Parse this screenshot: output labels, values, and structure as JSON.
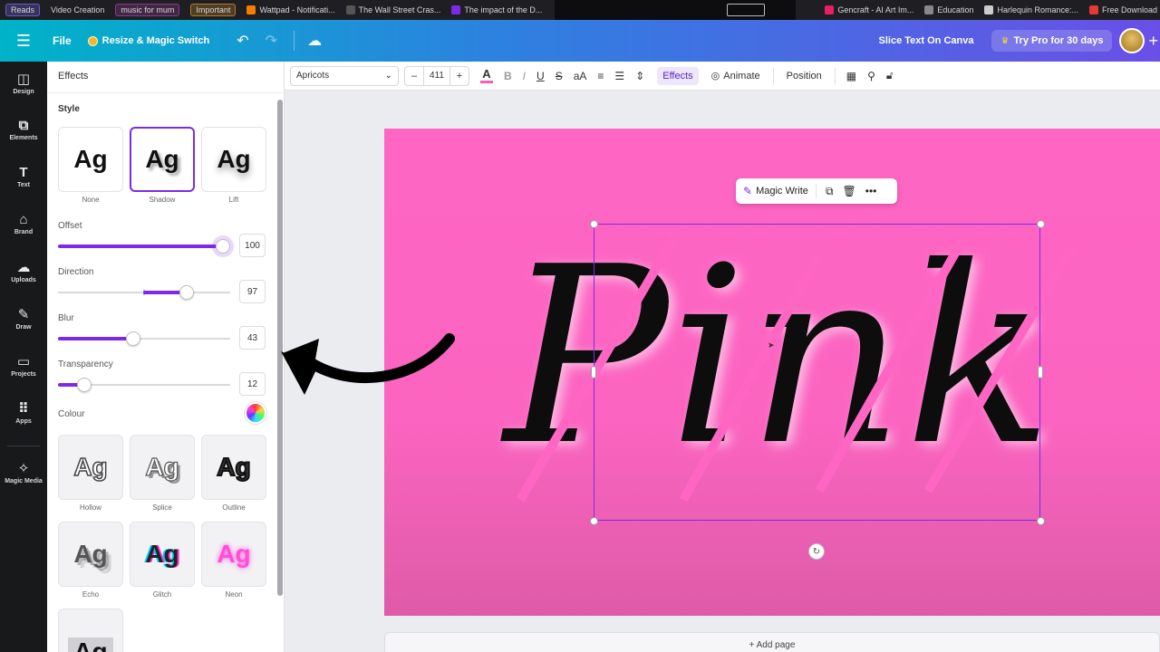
{
  "bookmarks": {
    "items": [
      {
        "label": "Reads",
        "chip": true,
        "color": "#6a5acd"
      },
      {
        "label": "Video Creation",
        "chip": false,
        "color": ""
      },
      {
        "label": "music for mum",
        "chip": true,
        "color": "#8b3a8b"
      },
      {
        "label": "Important",
        "chip": true,
        "color": "#b57a2a"
      },
      {
        "label": "Wattpad - Notificati...",
        "chip": false,
        "color": "#f57c00"
      },
      {
        "label": "The Wall Street Cras...",
        "chip": false,
        "color": "#555555"
      },
      {
        "label": "The impact of the D...",
        "chip": false,
        "color": "#7d2ae8"
      }
    ],
    "right_items": [
      {
        "label": "Gencraft - AI Art Im...",
        "color": "#e91e63"
      },
      {
        "label": "Education",
        "color": "#888888"
      },
      {
        "label": "Harlequin Romance:...",
        "color": "#cccccc"
      },
      {
        "label": "Free Download Books",
        "color": "#e53935"
      }
    ]
  },
  "topbar": {
    "file": "File",
    "resize": "Resize & Magic Switch",
    "doc_title": "Slice Text On Canva",
    "try_pro": "Try Pro for 30 days"
  },
  "rail": {
    "items": [
      {
        "label": "Design",
        "icon": "design-icon",
        "glyph": "◫"
      },
      {
        "label": "Elements",
        "icon": "elements-icon",
        "glyph": "⧉"
      },
      {
        "label": "Text",
        "icon": "text-icon",
        "glyph": "T"
      },
      {
        "label": "Brand",
        "icon": "brand-icon",
        "glyph": "⌂"
      },
      {
        "label": "Uploads",
        "icon": "uploads-icon",
        "glyph": "☁"
      },
      {
        "label": "Draw",
        "icon": "draw-icon",
        "glyph": "✎"
      },
      {
        "label": "Projects",
        "icon": "projects-icon",
        "glyph": "▭"
      },
      {
        "label": "Apps",
        "icon": "apps-icon",
        "glyph": "⠿"
      },
      {
        "label": "Magic Media",
        "icon": "magic-media-icon",
        "glyph": "✧"
      }
    ]
  },
  "panel": {
    "title": "Effects",
    "style_heading": "Style",
    "style_sample": "Ag",
    "styles_top": [
      {
        "label": "None",
        "selected": false
      },
      {
        "label": "Shadow",
        "selected": true
      },
      {
        "label": "Lift",
        "selected": false
      }
    ],
    "sliders": [
      {
        "label": "Offset",
        "value": "100",
        "fraction": 1.0
      },
      {
        "label": "Direction",
        "value": "97",
        "fraction": 0.77
      },
      {
        "label": "Blur",
        "value": "43",
        "fraction": 0.43
      },
      {
        "label": "Transparency",
        "value": "12",
        "fraction": 0.12
      }
    ],
    "colour_label": "Colour",
    "styles_bottom": [
      {
        "label": "Hollow"
      },
      {
        "label": "Splice"
      },
      {
        "label": "Outline"
      },
      {
        "label": "Echo"
      },
      {
        "label": "Glitch"
      },
      {
        "label": "Neon"
      }
    ]
  },
  "toolbar": {
    "font": "Apricots",
    "size": "411",
    "minus": "–",
    "plus": "+",
    "effects": "Effects",
    "animate": "Animate",
    "position": "Position"
  },
  "canvas": {
    "word": "Pink",
    "page_color": "#ff66c4",
    "magic_write": "Magic Write",
    "add_page": "+ Add page"
  },
  "colors": {
    "accent": "#7d2ae8",
    "topbar_start": "#00b3c8",
    "topbar_end": "#6a4fe6"
  }
}
